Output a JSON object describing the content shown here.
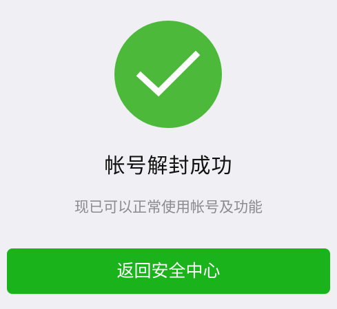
{
  "result": {
    "icon": "checkmark-icon",
    "title": "帐号解封成功",
    "message": "现已可以正常使用帐号及功能"
  },
  "actions": {
    "back_label": "返回安全中心"
  },
  "colors": {
    "background": "#efeff4",
    "success_circle": "#4cb93b",
    "button": "#1bb31b",
    "message_text": "#8a8a8f"
  }
}
